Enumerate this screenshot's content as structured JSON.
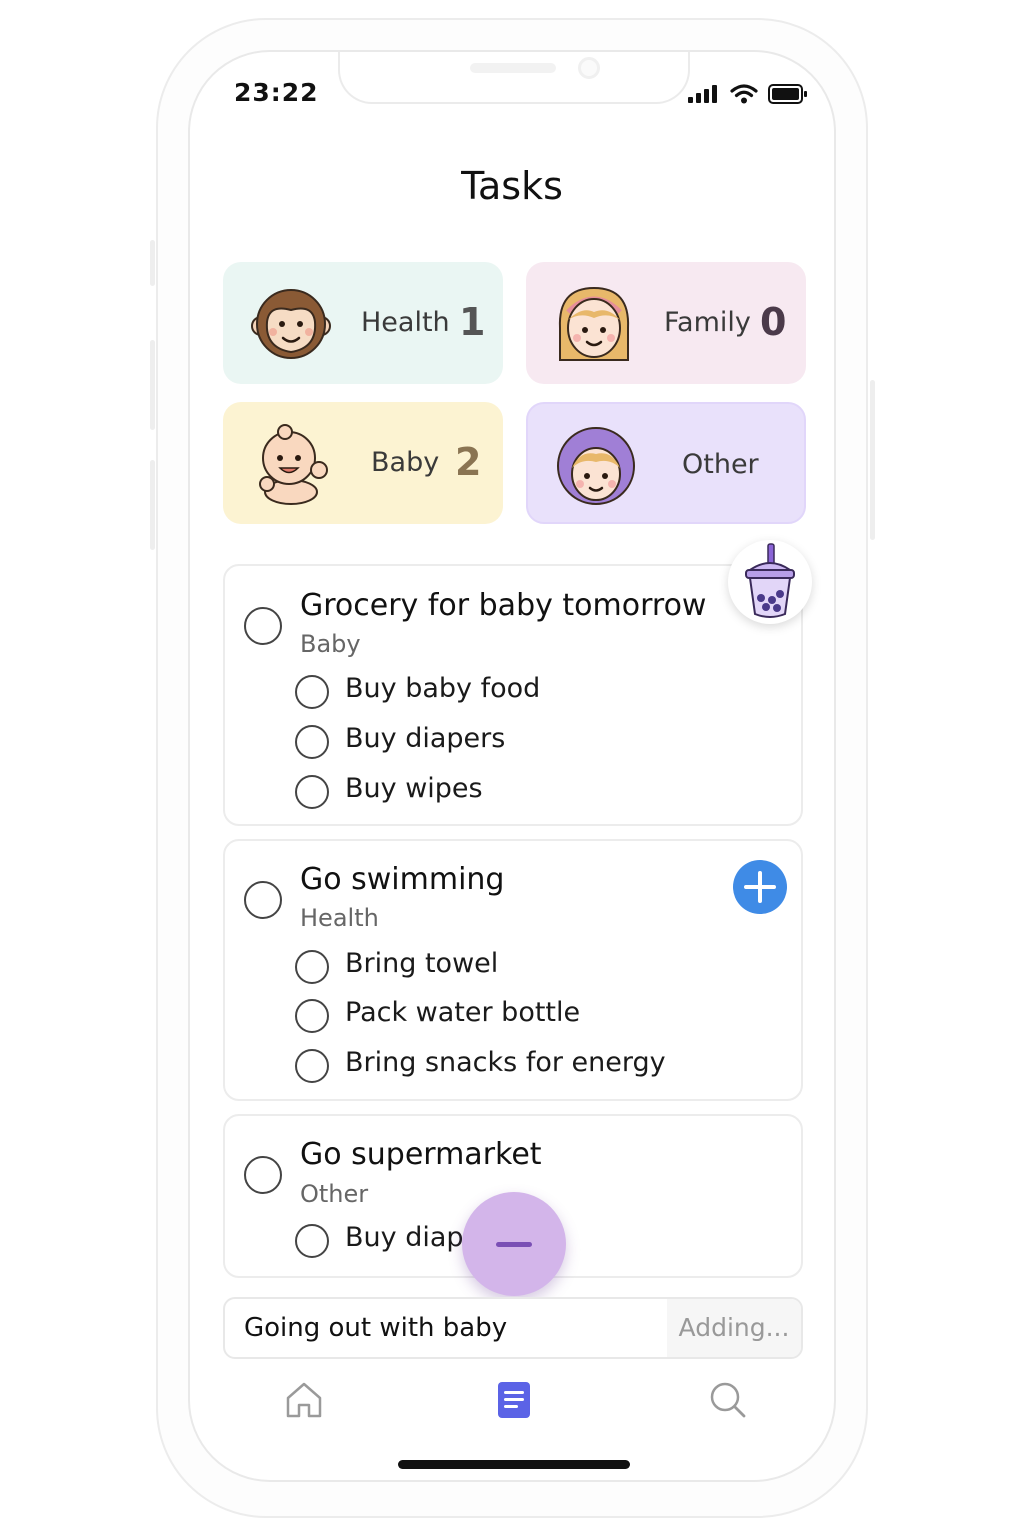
{
  "status_bar": {
    "time": "23:22"
  },
  "header": {
    "title": "Tasks"
  },
  "categories": [
    {
      "label": "Health",
      "count": "1",
      "bg": "#eaf6f3",
      "count_color": "#555555"
    },
    {
      "label": "Family",
      "count": "0",
      "bg": "#f7e9f1",
      "count_color": "#4b3a4a"
    },
    {
      "label": "Baby",
      "count": "2",
      "bg": "#fcf3d2",
      "count_color": "#8a7452"
    },
    {
      "label": "Other",
      "count": "",
      "bg": "#e9e1fb",
      "count_color": "#555555"
    }
  ],
  "tasks": [
    {
      "title": "Grocery for baby tomorrow",
      "category": "Baby",
      "subtasks": [
        "Buy baby food",
        "Buy diapers",
        "Buy wipes"
      ]
    },
    {
      "title": "Go swimming",
      "category": "Health",
      "subtasks": [
        "Bring towel",
        "Pack water bottle",
        "Bring snacks for energy"
      ]
    },
    {
      "title": "Go supermarket",
      "category": "Other",
      "subtasks": [
        "Buy diape"
      ]
    }
  ],
  "new_task": {
    "value": "Going out with baby",
    "status": "Adding..."
  },
  "tab_bar": {
    "items": [
      "home-icon",
      "tasks-icon",
      "search-icon"
    ],
    "active": "tasks-icon",
    "active_color": "#5b63e6"
  },
  "colors": {
    "accent_blue": "#3f8be6",
    "fab": "#d3b5ea"
  }
}
